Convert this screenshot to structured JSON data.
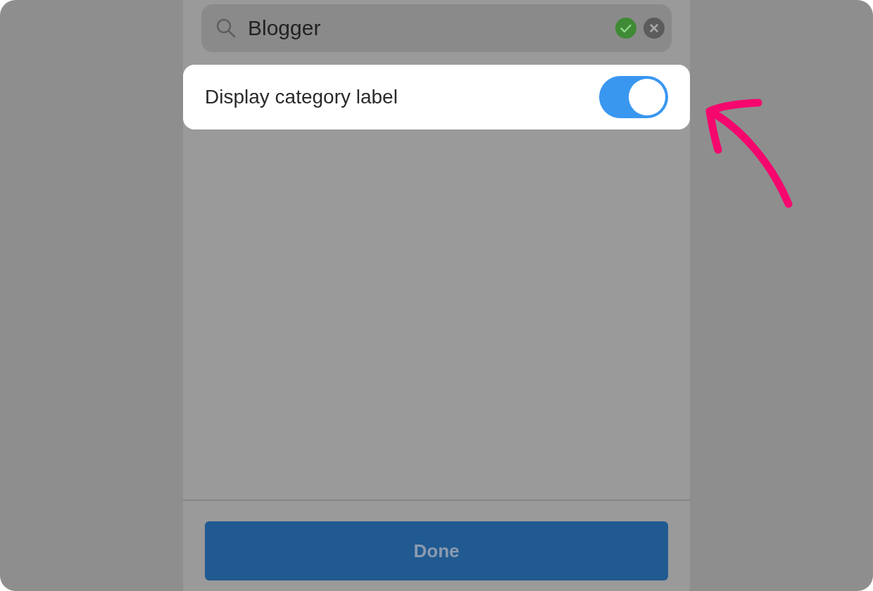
{
  "search": {
    "value": "Blogger"
  },
  "setting": {
    "label": "Display category label",
    "on": true
  },
  "done_button": {
    "label": "Done",
    "disabled": true
  }
}
